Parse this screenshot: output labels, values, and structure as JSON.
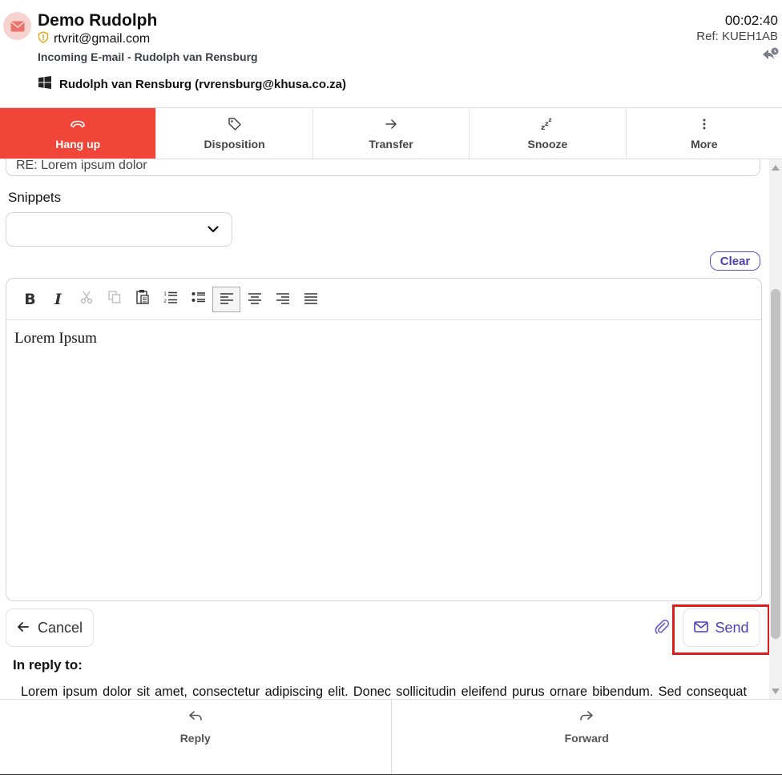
{
  "header": {
    "contact_name": "Demo Rudolph",
    "email": "rtvrit@gmail.com",
    "subtitle": "Incoming E-mail - Rudolph van Rensburg",
    "mailbox": "Rudolph van Rensburg (rvrensburg@khusa.co.za)",
    "timer": "00:02:40",
    "ref": "Ref: KUEH1AB"
  },
  "toolbar": {
    "items": [
      {
        "label": "Hang up",
        "icon": "phone-hangup-icon",
        "active": true
      },
      {
        "label": "Disposition",
        "icon": "tag-icon",
        "active": false
      },
      {
        "label": "Transfer",
        "icon": "arrow-right-icon",
        "active": false
      },
      {
        "label": "Snooze",
        "icon": "snooze-icon",
        "active": false
      },
      {
        "label": "More",
        "icon": "more-vertical-icon",
        "active": false
      }
    ]
  },
  "compose": {
    "subject_value": "RE: Lorem ipsum dolor",
    "snippets_label": "Snippets",
    "snippets_selected": "",
    "clear_label": "Clear",
    "editor_tools": [
      "bold-icon",
      "italic-icon",
      "cut-icon",
      "copy-icon",
      "paste-icon",
      "numbered-list-icon",
      "bullet-list-icon",
      "align-left-icon",
      "align-center-icon",
      "align-right-icon",
      "align-justify-icon"
    ],
    "editor_text": "Lorem Ipsum",
    "cancel_label": "Cancel",
    "send_label": "Send"
  },
  "in_reply": {
    "label": "In reply to:",
    "body": "Lorem ipsum dolor sit amet, consectetur adipiscing elit. Donec sollicitudin eleifend purus ornare bibendum. Sed consequat ornare turpis. In ante lectus, auctor in porta nec, bibendum ut sapien. Sed odio ex, semper et tincidunt sit amet, sodales ut lorem. Nam a dapibus justo. Morbi ut lobortis mauris, non consectetur aliquet. Vestibulum ante ipsum primis."
  },
  "bottom": {
    "reply_label": "Reply",
    "forward_label": "Forward"
  },
  "colors": {
    "accent_red": "#f14539",
    "accent_purple": "#4b3fb8",
    "highlight_box": "#e01b1b"
  }
}
